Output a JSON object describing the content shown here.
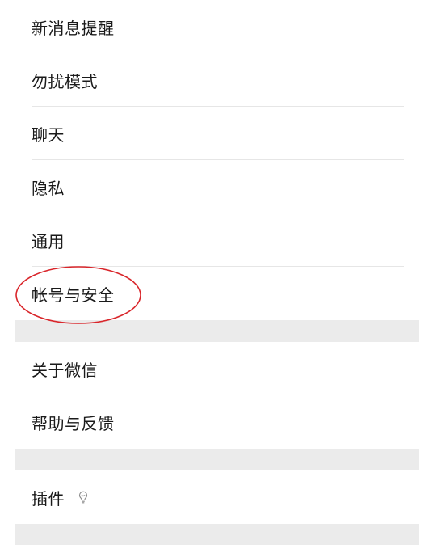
{
  "settings": {
    "new_message_alerts": "新消息提醒",
    "do_not_disturb": "勿扰模式",
    "chats": "聊天",
    "privacy": "隐私",
    "general": "通用",
    "account_security": "帐号与安全",
    "about_wechat": "关于微信",
    "help_feedback": "帮助与反馈",
    "plugins": "插件"
  },
  "icons": {
    "plugins_row_icon": "lightbulb-icon"
  },
  "colors": {
    "annotation": "#d9262b",
    "section_gap": "#ebebeb",
    "divider": "#e6e6e6"
  }
}
